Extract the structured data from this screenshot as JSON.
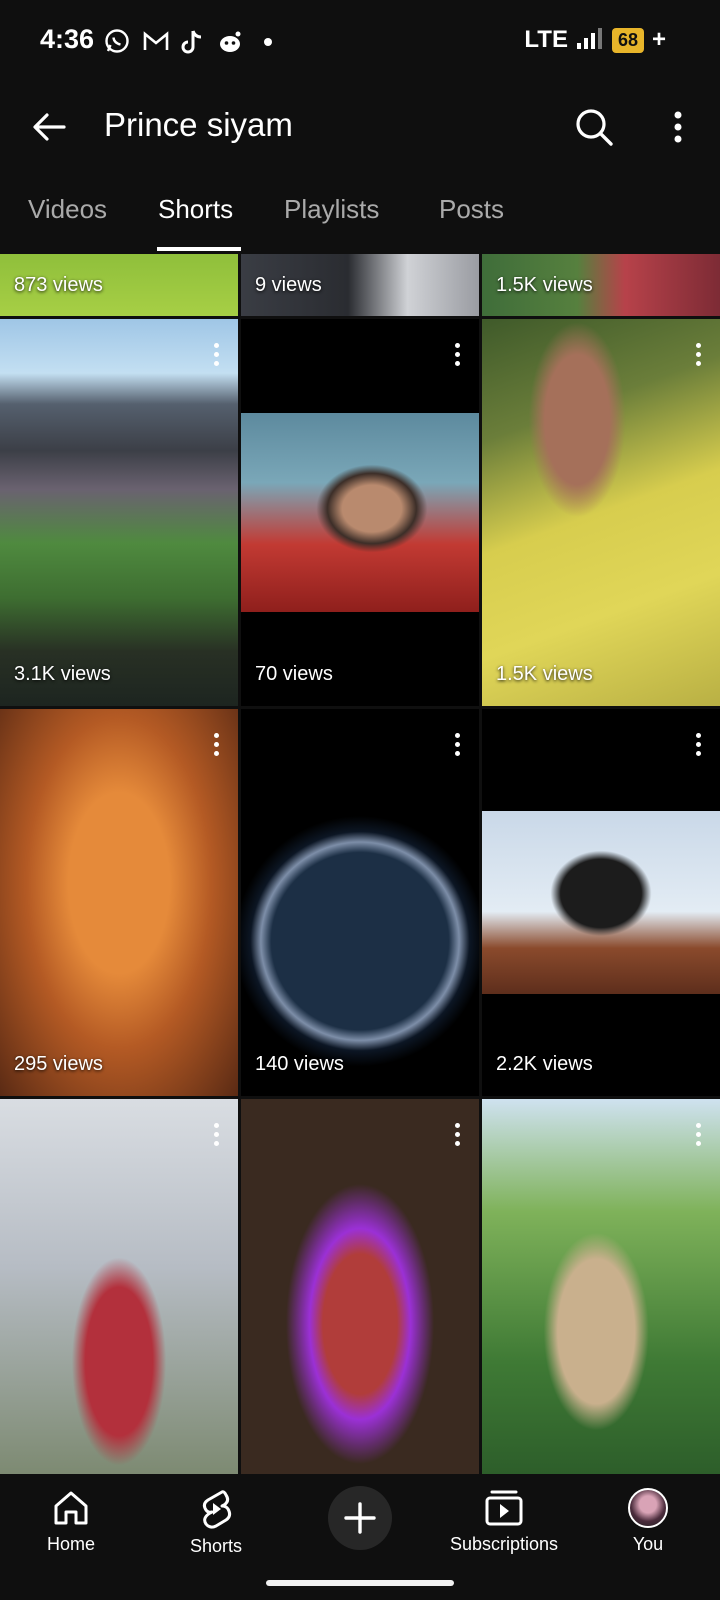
{
  "status_bar": {
    "time": "4:36",
    "network": "LTE",
    "battery": "68",
    "charging": "+",
    "notification_icons": [
      "whatsapp-icon",
      "gmail-icon",
      "tiktok-icon",
      "reddit-icon",
      "dot-icon"
    ]
  },
  "header": {
    "title": "Prince siyam",
    "icons": {
      "back": "arrow-back-icon",
      "search": "search-icon",
      "more": "more-vert-icon"
    }
  },
  "tabs": [
    {
      "label": "Videos",
      "active": false
    },
    {
      "label": "Shorts",
      "active": true
    },
    {
      "label": "Playlists",
      "active": false
    },
    {
      "label": "Posts",
      "active": false
    }
  ],
  "shorts": [
    {
      "views": "873 views",
      "thumb": "green field"
    },
    {
      "views": "9 views",
      "thumb": "stadium seats"
    },
    {
      "views": "1.5K views",
      "thumb": "crowd stands"
    },
    {
      "views": "3.1K views",
      "thumb": "stadium final"
    },
    {
      "views": "70 views",
      "thumb": "player red kit"
    },
    {
      "views": "1.5K views",
      "thumb": "player yellow kit"
    },
    {
      "views": "295 views",
      "thumb": "silhouette sunset"
    },
    {
      "views": "140 views",
      "thumb": "circular portrait"
    },
    {
      "views": "2.2K views",
      "thumb": "rooster cartoon"
    },
    {
      "views": "",
      "thumb": "man plaid shirt"
    },
    {
      "views": "",
      "thumb": "man purple glow"
    },
    {
      "views": "",
      "thumb": "man green background"
    }
  ],
  "bottom_nav": {
    "home": "Home",
    "shorts": "Shorts",
    "subscriptions": "Subscriptions",
    "you": "You"
  },
  "colors": {
    "background": "#0f0f0f",
    "text": "#f1f1f1",
    "muted": "#aaaaaa",
    "battery": "#e8b52a"
  }
}
